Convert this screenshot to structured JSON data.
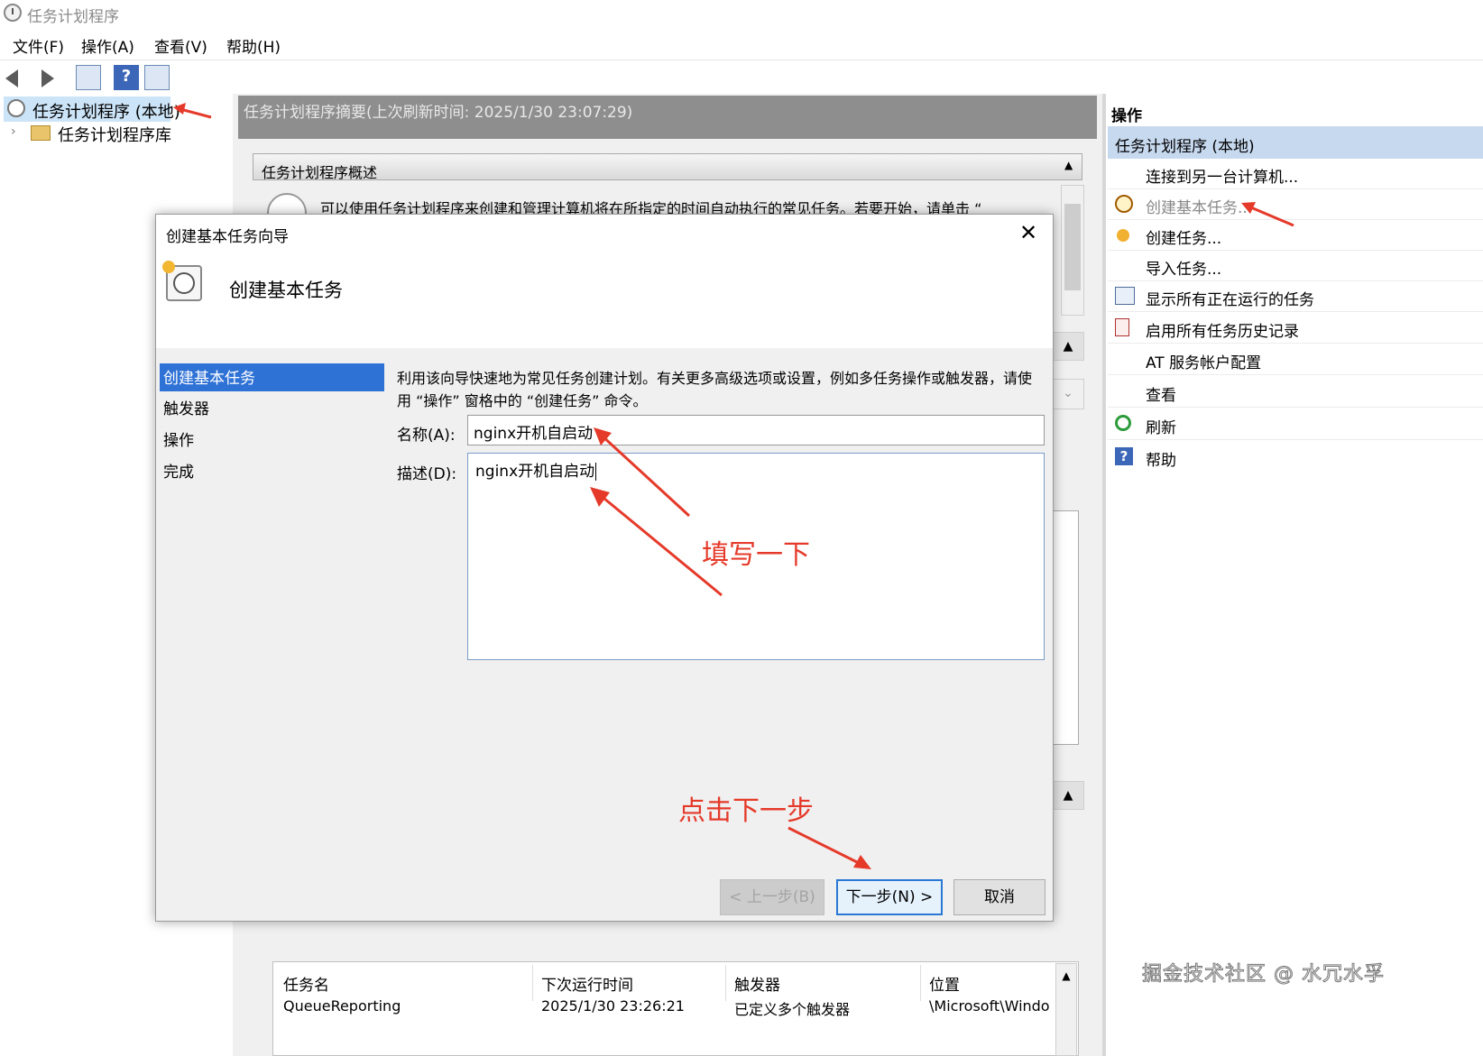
{
  "window": {
    "title": "任务计划程序"
  },
  "menu": [
    "文件(F)",
    "操作(A)",
    "查看(V)",
    "帮助(H)"
  ],
  "tree": {
    "root": "任务计划程序 (本地)",
    "library": "任务计划程序库"
  },
  "center": {
    "summary_header": "任务计划程序摘要(上次刷新时间: 2025/1/30 23:07:29)",
    "overview_title": "任务计划程序概述",
    "overview_desc": "可以使用任务计划程序来创建和管理计算机将在所指定的时间自动执行的常见任务。若要开始，请单击 “"
  },
  "actions": {
    "title": "操作",
    "section": "任务计划程序 (本地)",
    "items": [
      {
        "label": "连接到另一台计算机...",
        "icon": "none"
      },
      {
        "label": "创建基本任务...",
        "icon": "clock-icon"
      },
      {
        "label": "创建任务...",
        "icon": "sun-icon"
      },
      {
        "label": "导入任务...",
        "icon": "none"
      },
      {
        "label": "显示所有正在运行的任务",
        "icon": "list-icon"
      },
      {
        "label": "启用所有任务历史记录",
        "icon": "log-icon"
      },
      {
        "label": "AT 服务帐户配置",
        "icon": "none"
      },
      {
        "label": "查看",
        "icon": "none"
      },
      {
        "label": "刷新",
        "icon": "refresh-icon"
      },
      {
        "label": "帮助",
        "icon": "help-icon"
      }
    ]
  },
  "table": {
    "headers": [
      "任务名",
      "下次运行时间",
      "触发器",
      "位置"
    ],
    "row": [
      "QueueReporting",
      "2025/1/30 23:26:21",
      "已定义多个触发器",
      "\\Microsoft\\Windo"
    ]
  },
  "dialog": {
    "title": "创建基本任务向导",
    "heading": "创建基本任务",
    "steps": [
      "创建基本任务",
      "触发器",
      "操作",
      "完成"
    ],
    "description": "利用该向导快速地为常见任务创建计划。有关更多高级选项或设置，例如多任务操作或触发器，请使用 “操作” 窗格中的 “创建任务” 命令。",
    "name_label": "名称(A):",
    "name_value": "nginx开机自启动",
    "desc_label": "描述(D):",
    "desc_value": "nginx开机自启动",
    "buttons": {
      "back": "< 上一步(B)",
      "next": "下一步(N) >",
      "cancel": "取消"
    }
  },
  "annotations": {
    "fill": "填写一下",
    "click_next": "点击下一步",
    "color": "#e53a2a"
  },
  "watermark": "掘金技术社区 @ 水冗水孚"
}
